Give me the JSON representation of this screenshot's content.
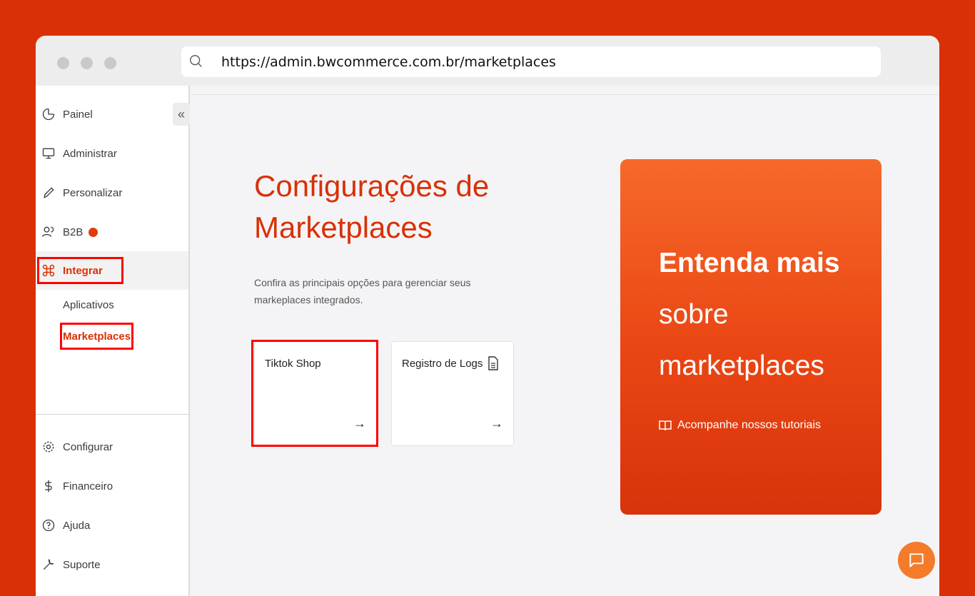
{
  "browser": {
    "url": "https://admin.bwcommerce.com.br/marketplaces"
  },
  "sidebar": {
    "collapse_label": "«",
    "items": [
      {
        "label": "Painel",
        "icon": "pie-chart-icon"
      },
      {
        "label": "Administrar",
        "icon": "monitor-icon"
      },
      {
        "label": "Personalizar",
        "icon": "pencil-icon"
      },
      {
        "label": "B2B",
        "icon": "users-icon"
      },
      {
        "label": "Integrar",
        "icon": "command-icon"
      },
      {
        "label": "Configurar",
        "icon": "gear-icon"
      },
      {
        "label": "Financeiro",
        "icon": "dollar-icon"
      },
      {
        "label": "Ajuda",
        "icon": "help-circle-icon"
      },
      {
        "label": "Suporte",
        "icon": "wrench-icon"
      }
    ],
    "subitems": [
      {
        "label": "Aplicativos"
      },
      {
        "label": "Marketplaces"
      }
    ]
  },
  "main": {
    "title_line1": "Configurações de",
    "title_line2": "Marketplaces",
    "description": "Confira as principais opções para gerenciar seus markeplaces integrados.",
    "cards": [
      {
        "title": "Tiktok Shop",
        "arrow": "→"
      },
      {
        "title": "Registro de Logs",
        "arrow": "→"
      }
    ]
  },
  "promo": {
    "line1": "Entenda mais",
    "line2": "sobre",
    "line3": "marketplaces",
    "link_label": "Acompanhe nossos tutoriais"
  },
  "colors": {
    "accent": "#d93006",
    "highlight": "#ff0000",
    "promo_gradient_top": "#f7692a",
    "promo_gradient_bottom": "#d8330a"
  }
}
